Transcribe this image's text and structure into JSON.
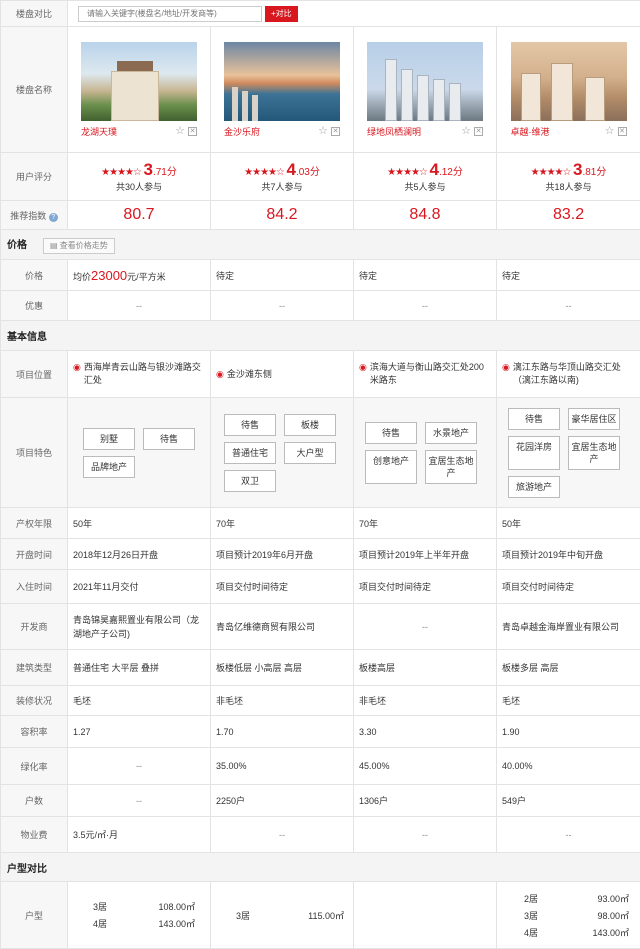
{
  "search": {
    "label": "楼盘对比",
    "placeholder": "请输入关键字(楼盘名/地址/开发商等)",
    "button": "+对比"
  },
  "labels": {
    "name": "楼盘名称",
    "rating": "用户评分",
    "index": "推荐指数",
    "price_section": "价格",
    "trend_button": "查看价格走势",
    "price": "价格",
    "discount": "优惠",
    "basic_section": "基本信息",
    "location": "项目位置",
    "features": "项目特色",
    "property_years": "产权年限",
    "open_time": "开盘时间",
    "move_in": "入住时间",
    "developer": "开发商",
    "building_type": "建筑类型",
    "decoration": "装修状况",
    "plot_ratio": "容积率",
    "greening": "绿化率",
    "households": "户数",
    "property_fee": "物业费",
    "unit_section": "户型对比",
    "unit": "户型"
  },
  "properties": [
    {
      "name": "龙湖天璞",
      "stars": "★★★★☆",
      "score_int": "3",
      "score_dec": ".71分",
      "count": "共30人参与",
      "index": "80.7",
      "price_prefix": "均价",
      "price_value": "23000",
      "price_suffix": "元/平方米",
      "price_status": "",
      "discount": "--",
      "location": "西海岸青云山路与银沙滩路交汇处",
      "tags": [
        "别墅",
        "待售",
        "品牌地产"
      ],
      "years": "50年",
      "open": "2018年12月26日开盘",
      "move_in": "2021年11月交付",
      "developer": "青岛锦昊嘉熙置业有限公司（龙湖地产子公司)",
      "building": "普通住宅 大平层 叠拼",
      "decoration": "毛坯",
      "plot": "1.27",
      "greening": "--",
      "households": "--",
      "fee": "3.5元/㎡·月",
      "units": [
        [
          "3居",
          "108.00㎡"
        ],
        [
          "4居",
          "143.00㎡"
        ]
      ]
    },
    {
      "name": "金沙乐府",
      "stars": "★★★★☆",
      "score_int": "4",
      "score_dec": ".03分",
      "count": "共7人参与",
      "index": "84.2",
      "price_prefix": "",
      "price_value": "",
      "price_suffix": "",
      "price_status": "待定",
      "discount": "--",
      "location": "金沙滩东侧",
      "tags": [
        "待售",
        "板楼",
        "普通住宅",
        "大户型",
        "双卫"
      ],
      "years": "70年",
      "open": "项目预计2019年6月开盘",
      "move_in": "项目交付时间待定",
      "developer": "青岛亿维德商贸有限公司",
      "building": "板楼低层 小高层 高层",
      "decoration": "非毛坯",
      "plot": "1.70",
      "greening": "35.00%",
      "households": "2250户",
      "fee": "--",
      "units": [
        [
          "3居",
          "115.00㎡"
        ]
      ]
    },
    {
      "name": "绿地凤栖澜明",
      "stars": "★★★★☆",
      "score_int": "4",
      "score_dec": ".12分",
      "count": "共5人参与",
      "index": "84.8",
      "price_prefix": "",
      "price_value": "",
      "price_suffix": "",
      "price_status": "待定",
      "discount": "--",
      "location": "滨海大道与衡山路交汇处200米路东",
      "tags": [
        "待售",
        "水景地产",
        "创意地产",
        "宜居生态地产"
      ],
      "years": "70年",
      "open": "项目预计2019年上半年开盘",
      "move_in": "项目交付时间待定",
      "developer": "--",
      "building": "板楼高层",
      "decoration": "非毛坯",
      "plot": "3.30",
      "greening": "45.00%",
      "households": "1306户",
      "fee": "--",
      "units": []
    },
    {
      "name": "卓越·维港",
      "stars": "★★★★☆",
      "score_int": "3",
      "score_dec": ".81分",
      "count": "共18人参与",
      "index": "83.2",
      "price_prefix": "",
      "price_value": "",
      "price_suffix": "",
      "price_status": "待定",
      "discount": "--",
      "location": "漓江东路与华顶山路交汇处（漓江东路以南)",
      "tags": [
        "待售",
        "豪华居住区",
        "花园洋房",
        "宜居生态地产",
        "旅游地产"
      ],
      "years": "50年",
      "open": "项目预计2019年中旬开盘",
      "move_in": "项目交付时间待定",
      "developer": "青岛卓越金海岸置业有限公司",
      "building": "板楼多层 高层",
      "decoration": "毛坯",
      "plot": "1.90",
      "greening": "40.00%",
      "households": "549户",
      "fee": "--",
      "units": [
        [
          "2居",
          "93.00㎡"
        ],
        [
          "3居",
          "98.00㎡"
        ],
        [
          "4居",
          "143.00㎡"
        ]
      ]
    }
  ]
}
